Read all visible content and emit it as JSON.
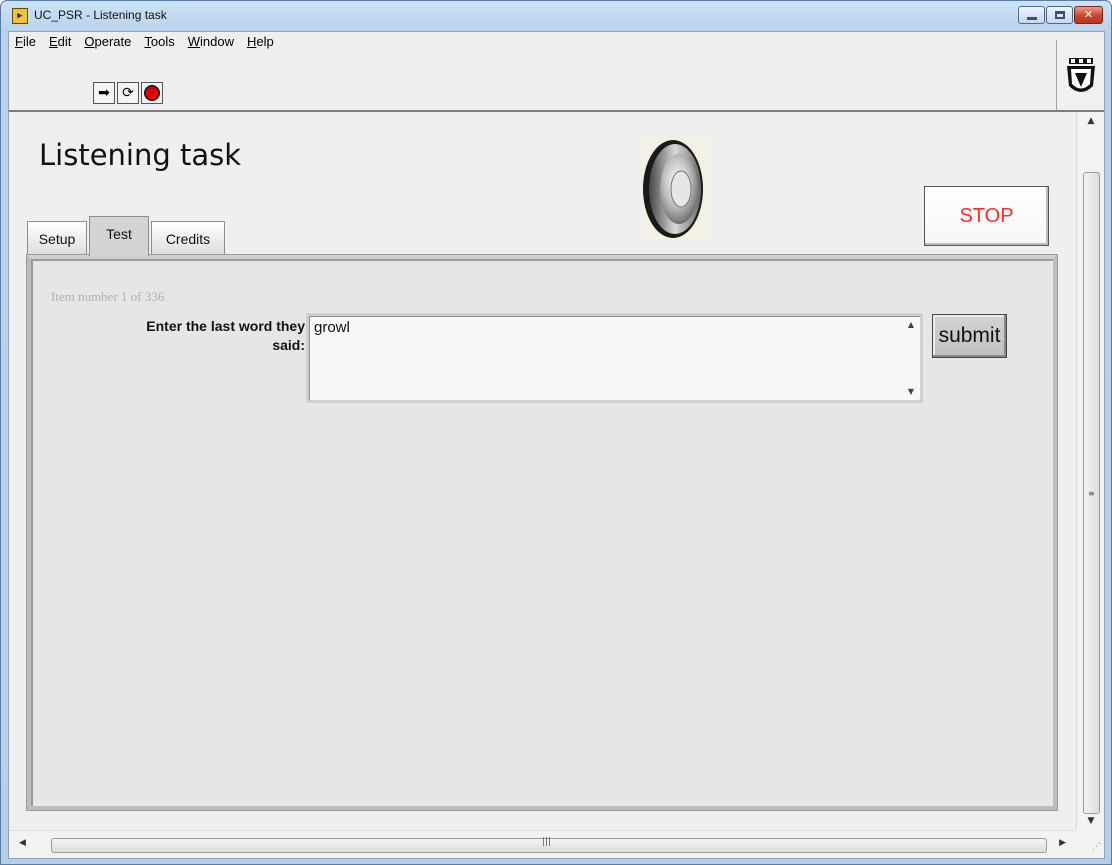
{
  "window": {
    "title": "UC_PSR - Listening task",
    "app_icon_glyph": "▶"
  },
  "menu": {
    "items": [
      {
        "label": "File",
        "mnemonic": "F",
        "rest": "ile"
      },
      {
        "label": "Edit",
        "mnemonic": "E",
        "rest": "dit"
      },
      {
        "label": "Operate",
        "mnemonic": "O",
        "rest": "perate"
      },
      {
        "label": "Tools",
        "mnemonic": "T",
        "rest": "ools"
      },
      {
        "label": "Window",
        "mnemonic": "W",
        "rest": "indow"
      },
      {
        "label": "Help",
        "mnemonic": "H",
        "rest": "elp"
      }
    ]
  },
  "toolbar": {
    "run_icon": "run-arrow-icon",
    "run_continuous_icon": "run-continuously-icon",
    "abort_icon": "abort-execution-icon",
    "run_glyph": "➡",
    "run_continuous_glyph": "⟳"
  },
  "panel": {
    "heading": "Listening task",
    "stop_label": "STOP"
  },
  "tabs": [
    {
      "label": "Setup",
      "active": false
    },
    {
      "label": "Test",
      "active": true
    },
    {
      "label": "Credits",
      "active": false
    }
  ],
  "test": {
    "item_number": "Item number 1 of 336",
    "prompt_line1": "Enter the last word they",
    "prompt_line2": "said:",
    "answer_value": "growl",
    "submit_label": "submit"
  },
  "colors": {
    "stop_text": "#ff2a2a",
    "abort_red": "#e00000",
    "app_icon_yellow": "#f1c232"
  }
}
